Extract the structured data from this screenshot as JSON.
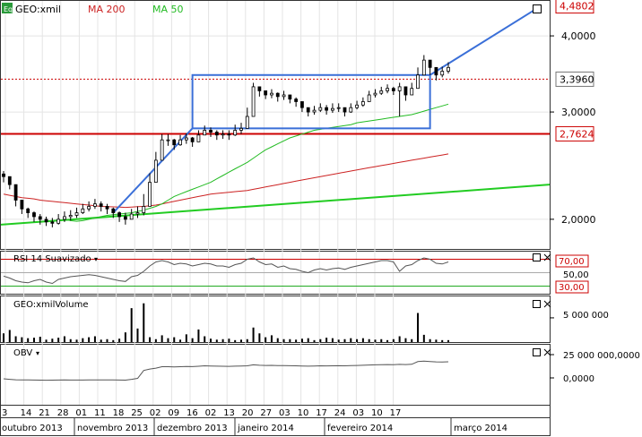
{
  "header": {
    "symbol_badge": "Eq",
    "symbol": "GEO:xmil",
    "ma200_label": "MA 200",
    "ma50_label": "MA 50",
    "ma200_color": "#cc2222",
    "ma50_color": "#22bb22"
  },
  "price_axis": {
    "ticks": [
      {
        "value": 4.0,
        "label": "4,0000"
      },
      {
        "value": 3.0,
        "label": "3,0000"
      },
      {
        "value": 2.0,
        "label": "2,0000"
      }
    ],
    "last_high_label": "4,4802",
    "last_high_value": 4.4802,
    "last_price_label": "3,3960",
    "last_price_value": 3.396,
    "support_label": "2,7624",
    "support_value": 2.7624
  },
  "rsi": {
    "title": "RSI 14 Suavizado",
    "upper_label": "70,00",
    "mid_label": "50,00",
    "lower_label": "30,00",
    "upper": 70,
    "mid": 50,
    "lower": 30
  },
  "volume": {
    "title": "GEO:xmilVolume",
    "tick_label": "5 000 000",
    "tick_value": 5000000
  },
  "obv": {
    "title": "OBV",
    "tick_top_label": "25 000 000,0000",
    "tick_zero_label": "0,0000",
    "tick_top_value": 25000000
  },
  "x_axis": {
    "day_labels": [
      "3",
      "14",
      "21",
      "28",
      "01",
      "11",
      "18",
      "25",
      "02",
      "09",
      "16",
      "02",
      "13",
      "20",
      "27",
      "03",
      "10",
      "17",
      "24",
      "03",
      "10",
      "17"
    ],
    "month_labels": [
      "outubro 2013",
      "novembro 2013",
      "dezembro 2013",
      "janeiro 2014",
      "fevereiro 2014",
      "março 2014"
    ]
  },
  "colors": {
    "up_candle": "#ffffff",
    "down_candle": "#000000",
    "trend_blue": "#3a6fd8",
    "red_line": "#cc0000",
    "green_line": "#22cc22"
  },
  "chart_data": [
    {
      "type": "candlestick",
      "title": "GEO:xmil",
      "scale": "log",
      "ylim": [
        1.8,
        4.55
      ],
      "close": [
        2.35,
        2.28,
        2.15,
        2.08,
        2.05,
        2.02,
        2.0,
        1.98,
        1.97,
        2.0,
        2.02,
        2.03,
        2.05,
        2.08,
        2.1,
        2.12,
        2.1,
        2.08,
        2.05,
        2.02,
        2.0,
        2.04,
        2.05,
        2.1,
        2.3,
        2.5,
        2.7,
        2.7,
        2.65,
        2.7,
        2.72,
        2.68,
        2.75,
        2.8,
        2.78,
        2.75,
        2.76,
        2.75,
        2.8,
        2.82,
        2.95,
        3.3,
        3.25,
        3.2,
        3.22,
        3.18,
        3.2,
        3.15,
        3.12,
        3.05,
        3.0,
        3.02,
        3.05,
        3.02,
        3.04,
        3.05,
        3.0,
        3.05,
        3.08,
        3.12,
        3.2,
        3.22,
        3.25,
        3.28,
        3.25,
        3.3,
        3.2,
        3.28,
        3.45,
        3.65,
        3.55,
        3.45,
        3.5,
        3.55
      ],
      "high": [
        2.4,
        2.33,
        2.2,
        2.13,
        2.09,
        2.06,
        2.04,
        2.02,
        2.01,
        2.04,
        2.06,
        2.07,
        2.09,
        2.12,
        2.14,
        2.16,
        2.14,
        2.12,
        2.09,
        2.06,
        2.05,
        2.08,
        2.1,
        2.2,
        2.38,
        2.58,
        2.76,
        2.76,
        2.71,
        2.75,
        2.77,
        2.73,
        2.8,
        2.85,
        2.83,
        2.8,
        2.8,
        2.8,
        2.86,
        2.88,
        3.05,
        3.35,
        3.3,
        3.25,
        3.27,
        3.23,
        3.25,
        3.2,
        3.17,
        3.1,
        3.05,
        3.07,
        3.1,
        3.08,
        3.1,
        3.1,
        3.05,
        3.1,
        3.13,
        3.17,
        3.25,
        3.27,
        3.3,
        3.33,
        3.3,
        3.35,
        3.27,
        3.35,
        3.55,
        3.72,
        3.62,
        3.52,
        3.56,
        3.62
      ],
      "low": [
        2.3,
        2.24,
        2.1,
        2.04,
        2.01,
        1.98,
        1.96,
        1.95,
        1.94,
        1.96,
        1.98,
        1.99,
        2.01,
        2.04,
        2.06,
        2.08,
        2.06,
        2.04,
        2.01,
        1.98,
        1.96,
        2.0,
        2.01,
        2.03,
        2.22,
        2.42,
        2.62,
        2.64,
        2.6,
        2.64,
        2.66,
        2.63,
        2.7,
        2.75,
        2.73,
        2.7,
        2.71,
        2.7,
        2.74,
        2.76,
        2.85,
        3.2,
        3.18,
        3.15,
        3.16,
        3.12,
        3.14,
        3.1,
        3.06,
        3.0,
        2.95,
        2.97,
        3.0,
        2.97,
        2.99,
        3.0,
        2.95,
        2.99,
        3.03,
        3.06,
        3.14,
        3.17,
        3.2,
        3.22,
        3.2,
        2.95,
        3.13,
        3.2,
        3.35,
        3.5,
        3.45,
        3.38,
        3.42,
        3.47
      ],
      "ma200": [
        2.2,
        2.19,
        2.18,
        2.17,
        2.165,
        2.16,
        2.15,
        2.145,
        2.14,
        2.135,
        2.13,
        2.125,
        2.12,
        2.115,
        2.11,
        2.105,
        2.1,
        2.098,
        2.096,
        2.094,
        2.092,
        2.095,
        2.098,
        2.1,
        2.105,
        2.11,
        2.12,
        2.13,
        2.14,
        2.15,
        2.16,
        2.17,
        2.18,
        2.19,
        2.2,
        2.205,
        2.21,
        2.215,
        2.22,
        2.225,
        2.23,
        2.24,
        2.25,
        2.26,
        2.27,
        2.28,
        2.29,
        2.3,
        2.31,
        2.32,
        2.33,
        2.34,
        2.35,
        2.36,
        2.37,
        2.38,
        2.39,
        2.4,
        2.41,
        2.42,
        2.43,
        2.44,
        2.45,
        2.46,
        2.47,
        2.48,
        2.49,
        2.5,
        2.51,
        2.52,
        2.53,
        2.54,
        2.55,
        2.56
      ],
      "ma50": [
        null,
        null,
        null,
        null,
        null,
        null,
        null,
        null,
        null,
        null,
        2.0,
        1.99,
        1.985,
        1.99,
        2.0,
        2.01,
        2.02,
        2.03,
        2.035,
        2.04,
        2.045,
        2.05,
        2.06,
        2.07,
        2.085,
        2.1,
        2.12,
        2.15,
        2.18,
        2.2,
        2.22,
        2.24,
        2.26,
        2.28,
        2.3,
        2.33,
        2.36,
        2.39,
        2.42,
        2.45,
        2.48,
        2.52,
        2.56,
        2.6,
        2.63,
        2.66,
        2.69,
        2.72,
        2.74,
        2.76,
        2.78,
        2.8,
        2.81,
        2.82,
        2.83,
        2.84,
        2.85,
        2.86,
        2.88,
        2.89,
        2.9,
        2.91,
        2.92,
        2.93,
        2.94,
        2.95,
        2.96,
        2.97,
        2.99,
        3.01,
        3.03,
        3.05,
        3.07,
        3.09
      ]
    },
    {
      "type": "line",
      "title": "RSI 14 Suavizado",
      "ylim": [
        20,
        80
      ],
      "values": [
        45,
        42,
        38,
        36,
        35,
        38,
        40,
        36,
        34,
        40,
        42,
        44,
        45,
        46,
        47,
        46,
        44,
        42,
        40,
        38,
        37,
        44,
        46,
        52,
        60,
        66,
        68,
        66,
        62,
        64,
        63,
        60,
        62,
        64,
        63,
        60,
        60,
        58,
        62,
        64,
        70,
        72,
        66,
        62,
        63,
        58,
        60,
        56,
        55,
        52,
        50,
        54,
        56,
        54,
        56,
        57,
        55,
        58,
        60,
        62,
        64,
        66,
        68,
        68,
        66,
        52,
        60,
        62,
        68,
        72,
        70,
        64,
        63,
        66
      ]
    },
    {
      "type": "bar",
      "title": "GEO:xmilVolume",
      "values": [
        1.8,
        2.5,
        1.2,
        1.0,
        0.8,
        0.9,
        1.1,
        0.5,
        0.7,
        0.9,
        1.2,
        0.6,
        0.5,
        0.8,
        1.0,
        1.2,
        0.5,
        0.6,
        0.4,
        0.7,
        2.0,
        7.0,
        2.8,
        8.0,
        1.0,
        0.6,
        1.4,
        0.8,
        1.0,
        0.5,
        1.6,
        0.8,
        2.6,
        1.2,
        0.7,
        0.5,
        0.6,
        0.7,
        0.4,
        0.5,
        0.6,
        3.0,
        1.8,
        1.0,
        1.4,
        0.8,
        0.6,
        0.6,
        0.5,
        0.7,
        0.8,
        0.4,
        0.6,
        0.9,
        0.8,
        0.5,
        0.6,
        0.8,
        0.6,
        0.8,
        0.6,
        0.5,
        0.6,
        0.4,
        0.6,
        1.2,
        0.8,
        0.6,
        6.0,
        1.5,
        0.6,
        0.5,
        0.4,
        0.4
      ]
    },
    {
      "type": "line",
      "title": "OBV",
      "values": [
        -1,
        -1.5,
        -2,
        -2.1,
        -2.2,
        -2.3,
        -2.4,
        -2.5,
        -2.4,
        -2.3,
        -2.2,
        -2.3,
        -2.35,
        -2.3,
        -2.2,
        -2.1,
        -2.15,
        -2.2,
        -2.25,
        -2.3,
        -2.4,
        -1.5,
        -0.5,
        8,
        9.5,
        10.5,
        12,
        12,
        11.8,
        12,
        12.2,
        12.1,
        12.5,
        13,
        12.8,
        12.6,
        12.5,
        12.4,
        12.6,
        12.8,
        13,
        14,
        13.6,
        13.4,
        13.5,
        13.2,
        13.3,
        13.1,
        13,
        12.8,
        12.6,
        12.8,
        13,
        12.9,
        13,
        13.1,
        13,
        13.2,
        13.4,
        13.6,
        13.8,
        14,
        14.2,
        14.3,
        14.1,
        14.5,
        14.3,
        14.6,
        17.5,
        18,
        17.6,
        17.2,
        17.1,
        17.3
      ]
    }
  ]
}
